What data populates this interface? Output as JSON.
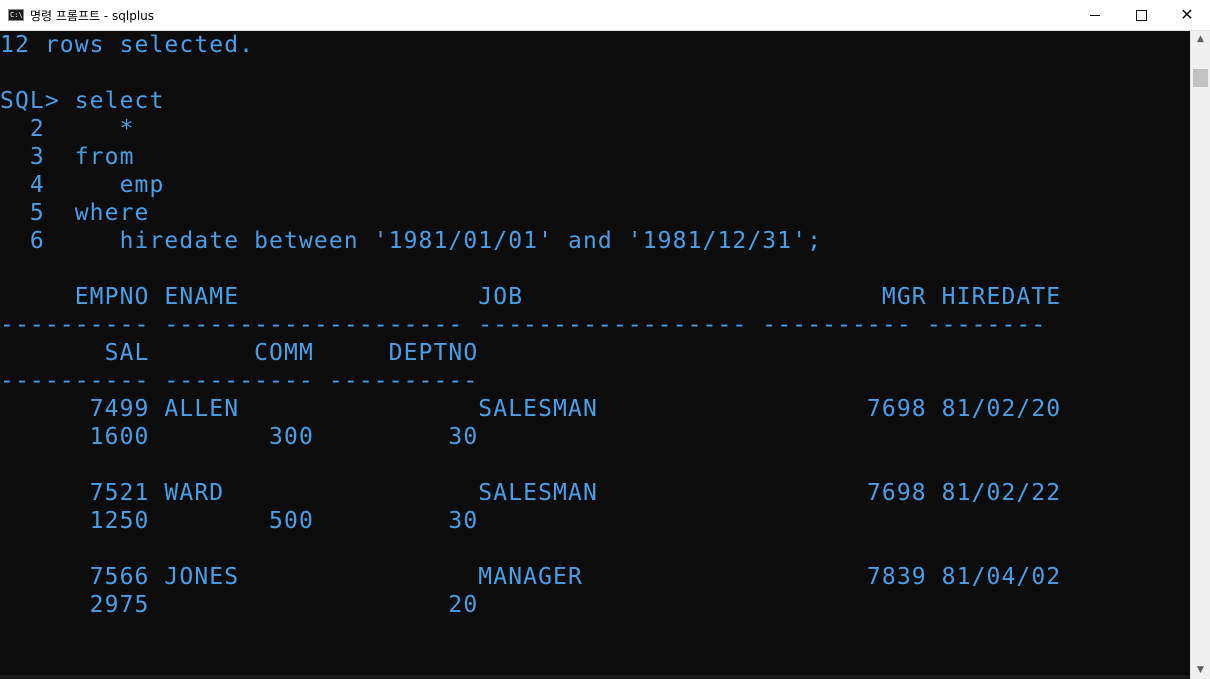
{
  "window": {
    "title": "명령 프롬프트 - sqlplus",
    "icon_text": "C:\\",
    "minimize_glyph": "",
    "maximize_glyph": "",
    "close_glyph": "✕"
  },
  "console": {
    "text_color": "#4a9ee6",
    "background": "#0c0c0c",
    "lines": [
      "12 rows selected.",
      "",
      "SQL> select",
      "  2     *",
      "  3  from",
      "  4     emp",
      "  5  where",
      "  6     hiredate between '1981/01/01' and '1981/12/31';",
      "",
      "     EMPNO ENAME                JOB                        MGR HIREDATE",
      "---------- -------------------- ------------------ ---------- --------",
      "       SAL       COMM     DEPTNO",
      "---------- ---------- ----------",
      "      7499 ALLEN                SALESMAN                  7698 81/02/20",
      "      1600        300         30",
      "",
      "      7521 WARD                 SALESMAN                  7698 81/02/22",
      "      1250        500         30",
      "",
      "      7566 JONES                MANAGER                   7839 81/04/02",
      "      2975                    20"
    ]
  },
  "scrollbar": {
    "up_arrow": "▲",
    "down_arrow": "▼"
  }
}
